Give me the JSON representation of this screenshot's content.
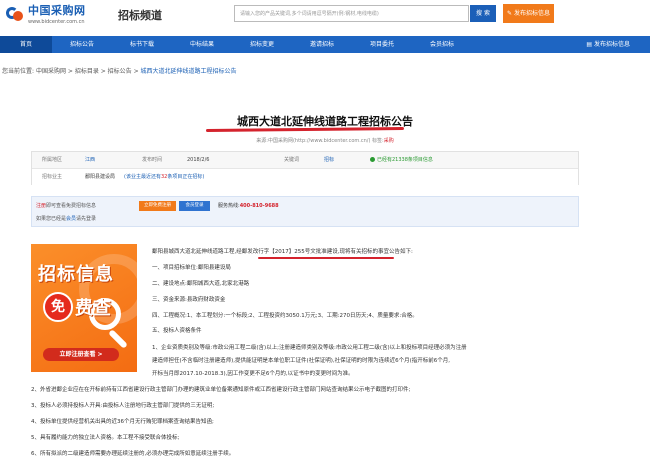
{
  "header": {
    "logo_cn": "中国采购网",
    "logo_url": "www.bidcenter.com.cn",
    "channel": "招标频道",
    "search_placeholder": "请输入您的产品关键词,多个词请用逗号隔开(例:钢材,电线电缆)",
    "search_label": "搜 索",
    "publish_label": "发布招标信息"
  },
  "nav": {
    "items": [
      "首页",
      "招标公告",
      "标书下载",
      "中标结果",
      "招标变更",
      "邀请招标",
      "项目委托",
      "会员招标"
    ],
    "active_index": 0,
    "right_label": "发布招标信息"
  },
  "breadcrumb": {
    "prefix": "您当前位置:",
    "items": [
      "中国采购网",
      "招标目录",
      "招标公告"
    ],
    "current": "城西大道北延伸线道路工程招标公告"
  },
  "article": {
    "title": "城西大道北延伸线道路工程招标公告",
    "source_prefix": "来源:",
    "source_text": "中国采购网(http://www.bidcenter.com.cn/)",
    "source_tag_label": "标签:",
    "source_tag_value": "采购"
  },
  "info": {
    "row1": [
      {
        "label": "所属地区",
        "value": "江西"
      },
      {
        "label": "发布时间",
        "value": "2018/2/6"
      },
      {
        "label": "关键词",
        "value": "招标"
      },
      {
        "label": "",
        "value": "已经有21338条项目信息"
      }
    ],
    "row2": {
      "label": "招标业主",
      "value": "鄱阳县建设局",
      "note_prefix": "(该业主最近还有",
      "note_count": "32",
      "note_suffix": "条项目正在招标)"
    }
  },
  "login_box": {
    "line1_prefix": "注册",
    "line1_mid": "即可查看免费招标信息",
    "register_btn": "立即免费注册",
    "login_btn": "会员登录",
    "hotline_label": "服务热线:",
    "hotline_number": "400-810-9688",
    "line2_prefix": "如果您已经是",
    "line2_link": "会员",
    "line2_suffix": "请先登录"
  },
  "banner": {
    "line1": "招标信息",
    "mian": "免",
    "fei": "费查",
    "cta": "立即注册查看 >"
  },
  "body": {
    "intro_a": "鄱阳县城西大道北延伸线道路工程,",
    "intro_b": "经鄱发改行字【2017】255号文批准建设,",
    "intro_c": "现将有关招标的事宜公告如下:",
    "p1": "一、项目招标单位:鄱阳县建设局",
    "p2": "二、建设地点:鄱阳城西大道,北家北港路",
    "p3": "三、资金来源:县政府财政资金",
    "p4": "四、工程概况:1、本工程划分:一个标段;2、工程投资约3050.1万元;3、工期:270日历天;4、质量要求:合格。",
    "p5": "五、投标人资格条件",
    "p6": "1、企业资质类别及等级:市政公用工程二级(含)以上;注册建造师类别及等级:市政公用工程二级(含)以上和投标项目经理必须为注册",
    "p7": "建造师担任(不含临时注册建造师),提供能证明是本单位职工证件(社保证明),社保证明的时限为连续近6个月(指开标前6个月,",
    "p8": "开标当月即2017.10-2018.3),因工作变更不足6个月的,以证书中的变更时间为准。",
    "p9": "2、外省进鄱企业应在在开标前持有江西省建设行政主管部门办理的建筑业单位备案通知原件或江西省建设行政主管部门网站查询结果公示电子截图的打印件;",
    "p10": "3、投标人必须持投标人开具:由投标人注册地行政主管部门提供的三无证明;",
    "p11": "4、投标单位提供经营机关出具的近36个月无行贿犯罪档案查询结果告知函;",
    "p12": "5、具有履约能力的独立法人资格。本工程不接受联合体投标;",
    "p13": "6、所有拟派的二级建造师需要办理延续注册的,必须办理完成所如意延续注册手续。"
  }
}
